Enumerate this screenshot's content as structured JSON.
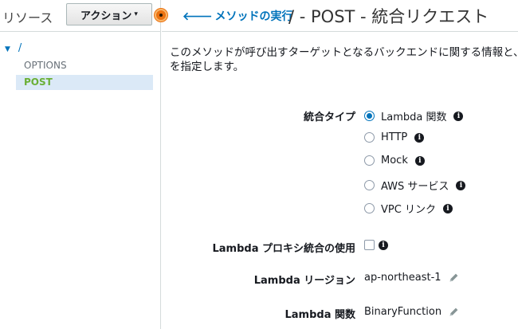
{
  "left_panel": {
    "title": "リソース",
    "action_button": "アクション",
    "action_caret": "▾",
    "tree": {
      "root_toggle": "▼",
      "root": "/",
      "items": [
        "OPTIONS",
        "POST"
      ]
    }
  },
  "header": {
    "back_arrow": "🡐",
    "back_link": "メソッドの実行",
    "title": "/ - POST - 統合リクエスト"
  },
  "description": {
    "line1": "このメソッドが呼び出すターゲットとなるバックエンドに関する情報と、統合リクエストデータの変更方法",
    "line2": "を指定します。"
  },
  "form": {
    "integration_type_label": "統合タイプ",
    "options": [
      {
        "label": "Lambda 関数",
        "selected": true
      },
      {
        "label": "HTTP",
        "selected": false
      },
      {
        "label": "Mock",
        "selected": false
      },
      {
        "label": "AWS サービス",
        "selected": false
      },
      {
        "label": "VPC リンク",
        "selected": false
      }
    ],
    "proxy_label": "Lambda プロキシ統合の使用",
    "proxy_checked": false,
    "region_label": "Lambda リージョン",
    "region_value": "ap-northeast-1",
    "function_label": "Lambda 関数",
    "function_value": "BinaryFunction",
    "info_glyph": "i"
  },
  "colors": {
    "link": "#0073bb",
    "selected_bg": "#dbe9f7",
    "post_text": "#6aaf35",
    "accent_orange": "#ec7211"
  },
  "icons": {
    "info": "info-icon",
    "pencil": "pencil-icon",
    "back": "arrow-left-icon"
  }
}
